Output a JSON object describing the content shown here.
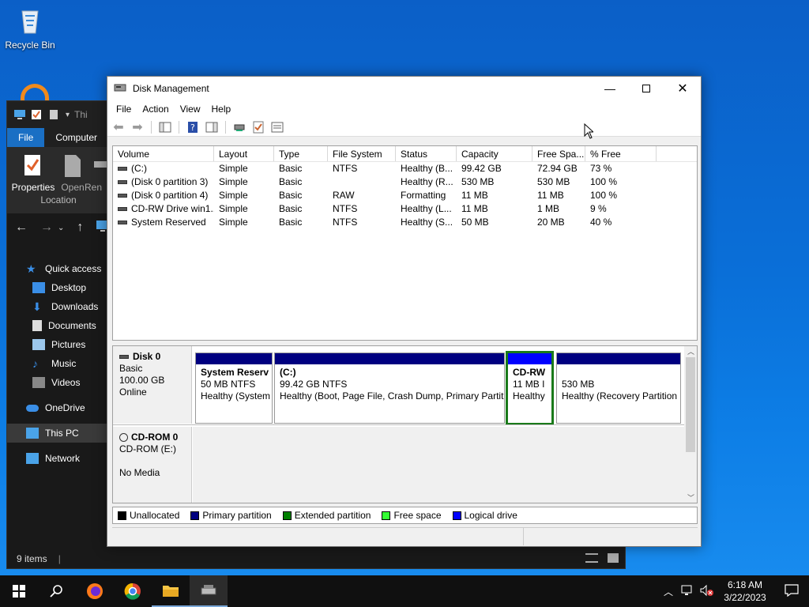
{
  "desktop": {
    "recycle_bin_label": "Recycle Bin"
  },
  "explorer": {
    "title_partial": "Thi",
    "ribbon_tabs": [
      "File",
      "Computer"
    ],
    "ribbon_buttons": [
      "Properties",
      "Open",
      "Ren"
    ],
    "ribbon_group": "Location",
    "nav": {
      "quick_access": "Quick access",
      "desktop": "Desktop",
      "downloads": "Downloads",
      "documents": "Documents",
      "pictures": "Pictures",
      "music": "Music",
      "videos": "Videos",
      "onedrive": "OneDrive",
      "this_pc": "This PC",
      "network": "Network"
    },
    "status_items": "9 items"
  },
  "diskmgmt": {
    "title": "Disk Management",
    "menu": [
      "File",
      "Action",
      "View",
      "Help"
    ],
    "columns": [
      "Volume",
      "Layout",
      "Type",
      "File System",
      "Status",
      "Capacity",
      "Free Spa...",
      "% Free"
    ],
    "volumes": [
      [
        "(C:)",
        "Simple",
        "Basic",
        "NTFS",
        "Healthy (B...",
        "99.42 GB",
        "72.94 GB",
        "73 %"
      ],
      [
        "(Disk 0 partition 3)",
        "Simple",
        "Basic",
        "",
        "Healthy (R...",
        "530 MB",
        "530 MB",
        "100 %"
      ],
      [
        "(Disk 0 partition 4)",
        "Simple",
        "Basic",
        "RAW",
        "Formatting",
        "11 MB",
        "11 MB",
        "100 %"
      ],
      [
        "CD-RW Drive win1...",
        "Simple",
        "Basic",
        "NTFS",
        "Healthy (L...",
        "11 MB",
        "1 MB",
        "9 %"
      ],
      [
        "System Reserved",
        "Simple",
        "Basic",
        "NTFS",
        "Healthy (S...",
        "50 MB",
        "20 MB",
        "40 %"
      ]
    ],
    "disk0": {
      "name": "Disk 0",
      "type": "Basic",
      "size": "100.00 GB",
      "state": "Online",
      "partitions": [
        {
          "name": "System Reserv",
          "size": "50 MB NTFS",
          "status": "Healthy (System"
        },
        {
          "name": "(C:)",
          "size": "99.42 GB NTFS",
          "status": "Healthy (Boot, Page File, Crash Dump, Primary Partit"
        },
        {
          "name": "CD-RW",
          "size": "11 MB I",
          "status": "Healthy"
        },
        {
          "name": "",
          "size": "530 MB",
          "status": "Healthy (Recovery Partition"
        }
      ]
    },
    "cdrom0": {
      "name": "CD-ROM 0",
      "type": "CD-ROM (E:)",
      "state": "No Media"
    },
    "legend": [
      "Unallocated",
      "Primary partition",
      "Extended partition",
      "Free space",
      "Logical drive"
    ],
    "legend_colors": [
      "#000000",
      "#000080",
      "#008000",
      "#33ff33",
      "#0000ff"
    ]
  },
  "taskbar": {
    "time": "6:18 AM",
    "date": "3/22/2023"
  }
}
